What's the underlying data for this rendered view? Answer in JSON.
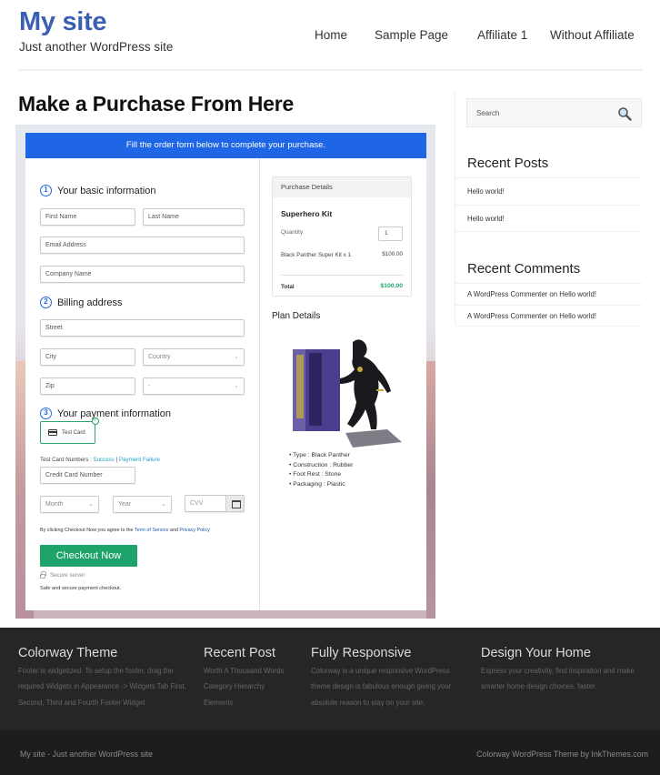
{
  "header": {
    "site_title": "My site",
    "tagline": "Just another WordPress site",
    "nav": [
      {
        "label": "Home"
      },
      {
        "label": "Sample Page"
      },
      {
        "label": "Affiliate 1"
      },
      {
        "label": "Without Affiliate"
      }
    ]
  },
  "main": {
    "page_title": "Make a Purchase From Here",
    "form": {
      "banner": "Fill the order form below to complete your purchase.",
      "steps": [
        {
          "num": "1",
          "label": "Your basic information"
        },
        {
          "num": "2",
          "label": "Billing address"
        },
        {
          "num": "3",
          "label": "Your payment information"
        }
      ],
      "fields": {
        "first_name": "First Name",
        "last_name": "Last Name",
        "email": "Email Address",
        "company": "Company Name",
        "street": "Street",
        "city": "City",
        "country": "Country",
        "zip": "Zip",
        "state": "-",
        "card_number": "Credit Card Number",
        "month": "Month",
        "year": "Year",
        "cvv": "CVV"
      },
      "payment_method": "Test Card",
      "test_card_numbers_label": "Test Card Numbers : ",
      "test_success": "Success",
      "test_separator": " | ",
      "test_failure": "Payment Failure",
      "agree_prefix": "By clicking Checkout Now you agree to the ",
      "terms_link": "Term of Service",
      "agree_and": " and ",
      "privacy_link": "Privacy Policy",
      "checkout_button": "Checkout Now",
      "secure_server": "Secure server",
      "safe_text": "Safe and secure payment checkout."
    },
    "purchase_details": {
      "heading": "Purchase Details",
      "product": "Superhero Kit",
      "quantity_label": "Quantity",
      "quantity_value": "1",
      "line_item": "Black Panther Super Kit x 1",
      "line_price": "$100.00",
      "total_label": "Total",
      "total_value": "$100.00"
    },
    "plan_details": {
      "heading": "Plan Details",
      "image_alt": "Black Panther figure with box",
      "features": [
        "Type : Black Panther",
        "Construction : Rubber",
        "Foot Rest : Stone",
        "Packaging : Plastic"
      ]
    }
  },
  "sidebar": {
    "search_placeholder": "Search",
    "recent_posts_title": "Recent Posts",
    "recent_posts": [
      "Hello world!",
      "Hello world!"
    ],
    "recent_comments_title": "Recent Comments",
    "recent_comments": [
      {
        "author": "A WordPress Commenter",
        "on": " on ",
        "post": "Hello world!"
      },
      {
        "author": "A WordPress Commenter",
        "on": " on ",
        "post": "Hello world!"
      }
    ]
  },
  "footer": {
    "columns": [
      {
        "title": "Colorway Theme",
        "text": "Footer is widgetized. To setup the footer, drag the required Widgets in Appearance -> Widgets Tab First, Second, Third and Fourth Footer Widget"
      },
      {
        "title": "Recent Post",
        "links": [
          "Worth A Thousand Words",
          "Category Hierarchy",
          "Elements"
        ]
      },
      {
        "title": "Fully Responsive",
        "text": "Colorway is a unique responsive WordPress theme design is fabulous enough giving your absolute reason to stay on your site."
      },
      {
        "title": "Design Your Home",
        "text": "Express your creativity, find inspiration and make smarter home design choices, faster."
      }
    ],
    "bottom_left": "My site - Just another WordPress site",
    "bottom_right": "Colorway WordPress Theme by InkThemes.com"
  },
  "colors": {
    "brand_blue": "#3b5fb5",
    "banner_blue": "#1e66e6",
    "checkout_green": "#1ea46a",
    "footer_dark": "#262626"
  }
}
